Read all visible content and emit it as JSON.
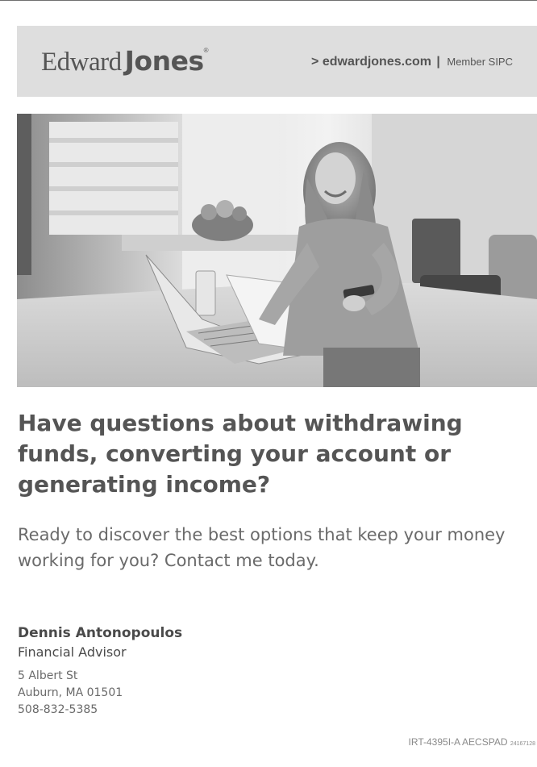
{
  "header": {
    "logo_edward": "Edward",
    "logo_jones": "Jones",
    "logo_reg": "®",
    "url": "> edwardjones.com",
    "separator": "|",
    "member": "Member SIPC"
  },
  "photo": {
    "icon": "woman-with-laptop-photo"
  },
  "headline": "Have questions about withdrawing funds, converting your account or generating income?",
  "lead": "Ready to discover the best options that keep your money working for you? Contact me today.",
  "contact": {
    "name": "Dennis Antonopoulos",
    "title": "Financial Advisor",
    "street": "5 Albert St",
    "city_line": "Auburn, MA 01501",
    "phone": "508-832-5385"
  },
  "footer": {
    "code": "IRT-4395I-A AECSPAD",
    "code_small": "24167128"
  },
  "colors": {
    "band": "#dedede",
    "text_dark": "#4a4a4a",
    "text_mid": "#6a6a6a"
  }
}
